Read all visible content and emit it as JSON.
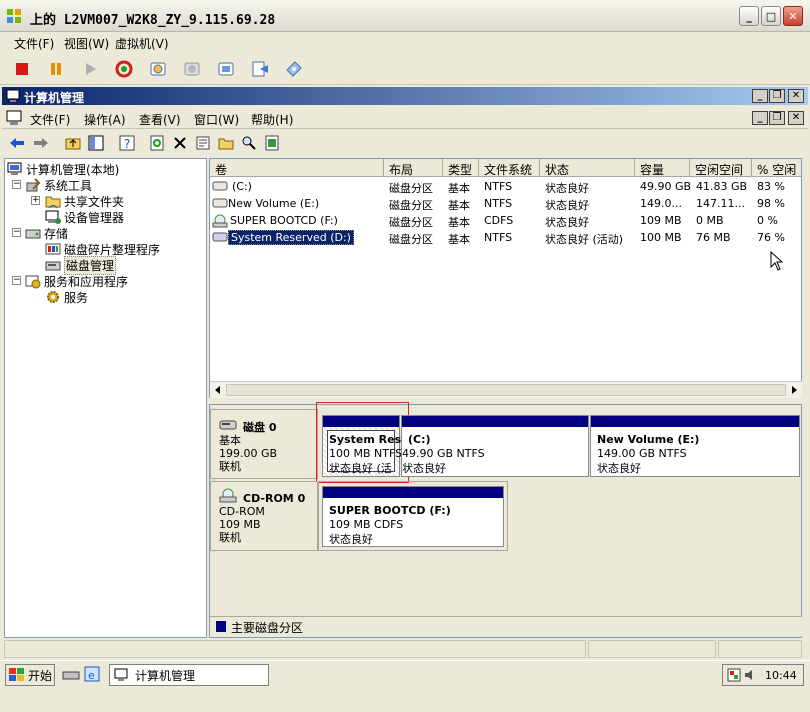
{
  "window_title": "上的 L2VM007_W2K8_ZY_9.115.69.28",
  "vm_menu": [
    "文件(F)",
    "视图(W)",
    "虚拟机(V)"
  ],
  "app": {
    "title": "计算机管理",
    "menu": [
      "文件(F)",
      "操作(A)",
      "查看(V)",
      "窗口(W)",
      "帮助(H)"
    ]
  },
  "tree": {
    "root": "计算机管理(本地)",
    "system_tools": "系统工具",
    "shared_folders": "共享文件夹",
    "device_manager": "设备管理器",
    "storage": "存储",
    "defrag": "磁盘碎片整理程序",
    "disk_mgmt": "磁盘管理",
    "services_apps": "服务和应用程序",
    "services": "服务"
  },
  "volume_list": {
    "columns": [
      "卷",
      "布局",
      "类型",
      "文件系统",
      "状态",
      "容量",
      "空闲空间",
      "% 空闲"
    ],
    "rows": [
      [
        "(C:)",
        "磁盘分区",
        "基本",
        "NTFS",
        "状态良好",
        "49.90 GB",
        "41.83 GB",
        "83 %"
      ],
      [
        "New Volume (E:)",
        "磁盘分区",
        "基本",
        "NTFS",
        "状态良好",
        "149.0...",
        "147.11...",
        "98 %"
      ],
      [
        "SUPER BOOTCD (F:)",
        "磁盘分区",
        "基本",
        "CDFS",
        "状态良好",
        "109 MB",
        "0 MB",
        "0 %"
      ],
      [
        "System Reserved (D:)",
        "磁盘分区",
        "基本",
        "NTFS",
        "状态良好 (活动)",
        "100 MB",
        "76 MB",
        "76 %"
      ]
    ]
  },
  "disks": [
    {
      "name": "磁盘 0",
      "type": "基本",
      "size": "199.00 GB",
      "status": "联机",
      "partitions": [
        {
          "name": "System Res",
          "detail": "100 MB NTFS",
          "state": "状态良好 (活"
        },
        {
          "name": "(C:)",
          "detail": "49.90 GB NTFS",
          "state": "状态良好"
        },
        {
          "name": "New Volume  (E:)",
          "detail": "149.00 GB NTFS",
          "state": "状态良好"
        }
      ]
    },
    {
      "name": "CD-ROM 0",
      "type": "CD-ROM",
      "size": "109 MB",
      "status": "联机",
      "partitions": [
        {
          "name": "SUPER BOOTCD  (F:)",
          "detail": "109 MB CDFS",
          "state": "状态良好"
        }
      ]
    }
  ],
  "legend": "主要磁盘分区",
  "taskbar": {
    "start": "开始",
    "task": "计算机管理",
    "clock": "10:44"
  },
  "colors": {
    "primary_partition": "#000080",
    "selection_highlight": "#e02020"
  }
}
